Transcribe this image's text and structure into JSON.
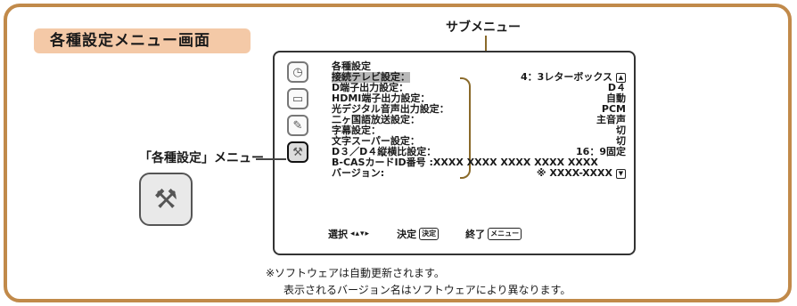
{
  "title": "各種設定メニュー画面",
  "submenu_label": "サブメニュー",
  "menu_callout_label": "「各種設定」メニュー",
  "side_icons": [
    "clock-icon",
    "tv-icon",
    "tool-icon",
    "toolbox-icon"
  ],
  "menu": {
    "heading": "各種設定",
    "rows": [
      {
        "label": "接続テレビ設定：",
        "value": "4：3レターボックス",
        "selected": true
      },
      {
        "label": "D端子出力設定：",
        "value": "D４"
      },
      {
        "label": "HDMI端子出力設定：",
        "value": "自動"
      },
      {
        "label": "光デジタル音声出力設定：",
        "value": "PCM"
      },
      {
        "label": "二ヶ国語放送設定：",
        "value": "主音声"
      },
      {
        "label": "字幕設定：",
        "value": "切"
      },
      {
        "label": "文字スーパー設定：",
        "value": "切"
      },
      {
        "label": "D３／D４縦横比設定：",
        "value": "16：9固定"
      }
    ],
    "bcas_line": "B-CASカードID番号 :XXXX XXXX XXXX XXXX XXXX",
    "version_label": "バージョン:",
    "version_value": "※ XXXX-XXXX"
  },
  "bottom_bar": {
    "select_label": "選択",
    "decide_label": "決定",
    "decide_key": "決定",
    "exit_label": "終了",
    "exit_key": "メニュー"
  },
  "notes": {
    "line1": "※ソフトウェアは自動更新されます。",
    "line2": "表示されるバージョン名はソフトウェアにより異なります。"
  },
  "colors": {
    "frame": "#c18a4a",
    "title_bg": "#f4c9a7",
    "bracket": "#8a6a2a",
    "selected_bg": "#b8b8b8"
  }
}
